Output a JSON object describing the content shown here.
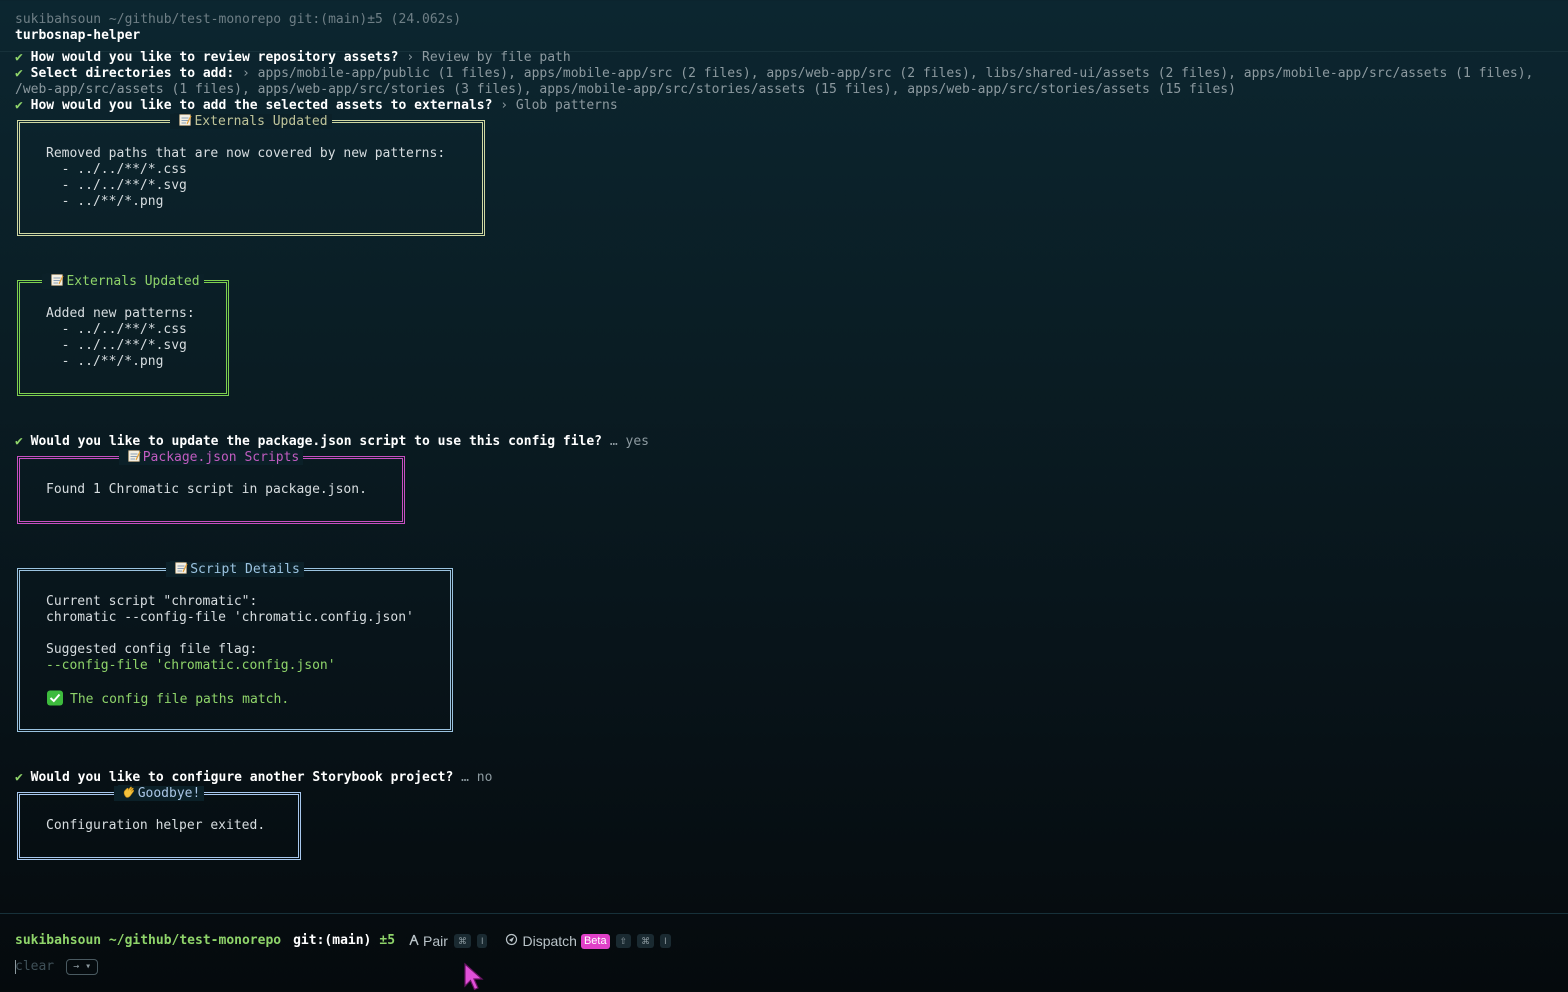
{
  "header": {
    "prev_prompt": "sukibahsoun ~/github/test-monorepo git:(main)±5 (24.062s)",
    "command": "turbosnap-helper"
  },
  "q1": {
    "check": "✔",
    "question": "How would you like to review repository assets?",
    "answer": "› Review by file path"
  },
  "q2": {
    "check": "✔",
    "question": "Select directories to add:",
    "answer_line1": "› apps/mobile-app/public (1 files), apps/mobile-app/src (2 files), apps/web-app/src (2 files), libs/shared-ui/assets (2 files), apps/mobile-app/src/assets (1 files),",
    "answer_line2": "/web-app/src/assets (1 files), apps/web-app/src/stories (3 files), apps/mobile-app/src/stories/assets (15 files), apps/web-app/src/stories/assets (15 files)"
  },
  "q3": {
    "check": "✔",
    "question": "How would you like to add the selected assets to externals?",
    "answer": "› Glob patterns"
  },
  "box1": {
    "icon": "memo-icon",
    "title": "Externals Updated",
    "lines": [
      "Removed paths that are now covered by new patterns:",
      "  - ../../**/*.css",
      "  - ../../**/*.svg",
      "  - ../**/*.png"
    ]
  },
  "box2": {
    "icon": "memo-icon",
    "title": "Externals Updated",
    "lines": [
      "Added new patterns:",
      "  - ../../**/*.css",
      "  - ../../**/*.svg",
      "  - ../**/*.png"
    ]
  },
  "q4": {
    "check": "✔",
    "question": "Would you like to update the package.json script to use this config file?",
    "answer": "… yes"
  },
  "box3": {
    "icon": "memo-icon",
    "title": "Package.json Scripts",
    "lines": [
      "Found 1 Chromatic script in package.json."
    ]
  },
  "box4": {
    "icon": "memo-icon",
    "title": "Script Details",
    "current_label": "Current script \"chromatic\":",
    "current_cmd": "chromatic --config-file 'chromatic.config.json'",
    "suggested_label": "Suggested config file flag:",
    "suggested_flag": "--config-file 'chromatic.config.json'",
    "match_text": "The config file paths match.",
    "match_icon": "check-mark-button-icon"
  },
  "q5": {
    "check": "✔",
    "question": "Would you like to configure another Storybook project?",
    "answer": "… no"
  },
  "box5": {
    "icon": "waving-hand-icon",
    "title": "Goodbye!",
    "lines": [
      "Configuration helper exited."
    ]
  },
  "prompt": {
    "user_path": "sukibahsoun ~/github/test-monorepo",
    "git": "git:(main)",
    "changes": "±5",
    "pair_label": "Pair",
    "pair_keys": [
      "⌘",
      "I"
    ],
    "dispatch_label": "Dispatch",
    "beta_badge": "Beta",
    "dispatch_keys": [
      "⇧",
      "⌘",
      "I"
    ],
    "input_placeholder": "clear",
    "enter_label": "→ ▾"
  },
  "colors": {
    "accent_green": "#8fd46a",
    "beta_pink": "#e040c8",
    "box1_border": "#cfd7a2",
    "box2_border": "#7ed04f",
    "box3_border": "#c64fc0",
    "box4_border": "#9bc3e0",
    "box5_border": "#a8c8ee"
  }
}
